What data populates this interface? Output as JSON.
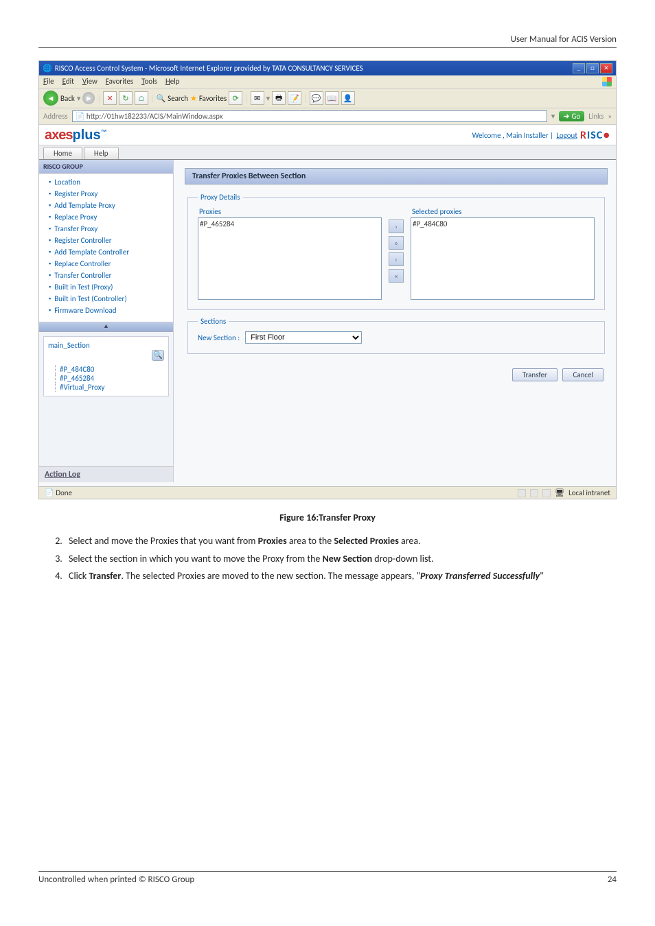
{
  "header": {
    "right": "User Manual for ACIS Version"
  },
  "browser": {
    "title": "RISCO Access Control System - Microsoft Internet Explorer provided by TATA CONSULTANCY SERVICES",
    "menus": [
      "File",
      "Edit",
      "View",
      "Favorites",
      "Tools",
      "Help"
    ],
    "toolbar": {
      "back": "Back",
      "search": "Search",
      "favorites": "Favorites"
    },
    "address_label": "Address",
    "address": "http://01hw182233/ACIS/MainWindow.aspx",
    "go": "Go",
    "links": "Links",
    "status_left": "Done",
    "status_right": "Local intranet"
  },
  "app": {
    "brand": "axesplus",
    "welcome": "Welcome ,  Main Installer  |",
    "logout": "Logout",
    "risco": "RISC",
    "tabs": [
      "Home",
      "Help"
    ],
    "group": "RISCO GROUP",
    "nav": [
      "Location",
      "Register Proxy",
      "Add Template Proxy",
      "Replace Proxy",
      "Transfer Proxy",
      "Register Controller",
      "Add Template Controller",
      "Replace Controller",
      "Transfer Controller",
      "Built in Test (Proxy)",
      "Built in Test (Controller)",
      "Firmware Download"
    ],
    "tree_root": "main_Section",
    "tree_children": [
      "#P_484C80",
      "#P_465284",
      "#Virtual_Proxy"
    ],
    "action_log": "Action Log",
    "section_title": "Transfer Proxies Between Section",
    "fieldset1": "Proxy Details",
    "proxies_label": "Proxies",
    "selected_label": "Selected proxies",
    "proxies_list": [
      "#P_465284"
    ],
    "selected_list": [
      "#P_484C80"
    ],
    "fieldset2": "Sections",
    "new_section_label": "New Section :",
    "new_section_value": "First Floor",
    "btn_transfer": "Transfer",
    "btn_cancel": "Cancel",
    "collapse": "«"
  },
  "figure_caption": "Figure 16:Transfer Proxy",
  "steps": {
    "s2_a": "Select and move the Proxies that you want from ",
    "s2_b": "Proxies",
    "s2_c": " area to the ",
    "s2_d": "Selected Proxies",
    "s2_e": " area.",
    "s3_a": "Select the section in which you want to move the Proxy from the ",
    "s3_b": "New Section",
    "s3_c": " drop-down list.",
    "s4_a": "Click ",
    "s4_b": "Transfer",
    "s4_c": ". The selected Proxies are moved to the new section. The message appears, \"",
    "s4_d": "Proxy Transferred Successfully",
    "s4_e": "\""
  },
  "footer": {
    "left": "Uncontrolled when printed © RISCO Group",
    "right": "24"
  }
}
